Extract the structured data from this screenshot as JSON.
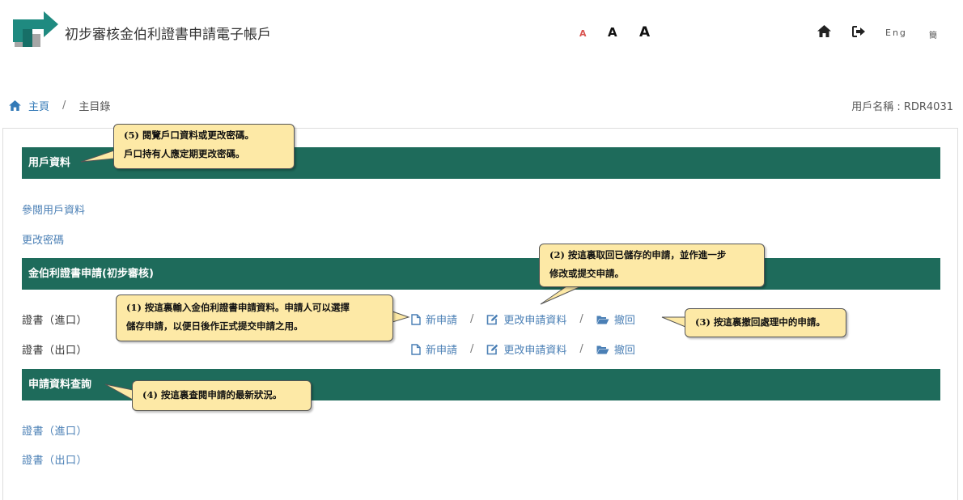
{
  "header": {
    "title": "初步審核金伯利證書申請電子帳戶",
    "font_sizes": [
      "A",
      "A",
      "A"
    ],
    "lang_en": "Eng",
    "lang_sc": "簡"
  },
  "breadcrumb": {
    "home": "主頁",
    "separator": "/",
    "current": "主目錄"
  },
  "user": {
    "label": "用戶名稱 : RDR4031"
  },
  "sections": {
    "account": {
      "title": "用戶資料",
      "links": [
        "參閱用戶資料",
        "更改密碼"
      ]
    },
    "application": {
      "title": "金伯利證書申請(初步審核)",
      "rows": [
        {
          "label": "證書（進口）",
          "actions": [
            "新申請",
            "更改申請資料",
            "撤回"
          ]
        },
        {
          "label": "證書（出口）",
          "actions": [
            "新申請",
            "更改申請資料",
            "撤回"
          ]
        }
      ],
      "action_separator": "/"
    },
    "enquiry": {
      "title": "申請資料查詢",
      "links": [
        "證書（進口）",
        "證書（出口）"
      ]
    }
  },
  "callouts": {
    "c5": [
      "(5) 閱覽戶口資料或更改密碼。",
      "戶口持有人應定期更改密碼。"
    ],
    "c2": [
      "(2) 按這裏取回已儲存的申請，並作進一步",
      "修改或提交申請。"
    ],
    "c1": [
      "(1)  按這裏輸入金伯利證書申請資料。申請人可以選擇",
      "儲存申請，以便日後作正式提交申請之用。"
    ],
    "c3": [
      "(3) 按這裏撤回處理中的申請。"
    ],
    "c4": [
      "(4) 按這裏查閱申請的最新狀況。"
    ]
  },
  "colors": {
    "section_bar": "#1e6b5b",
    "link": "#4a7fb5",
    "callout_bg": "#fde9a6",
    "logo_teal": "#1f8a80",
    "logo_gray": "#9e9e9e"
  }
}
